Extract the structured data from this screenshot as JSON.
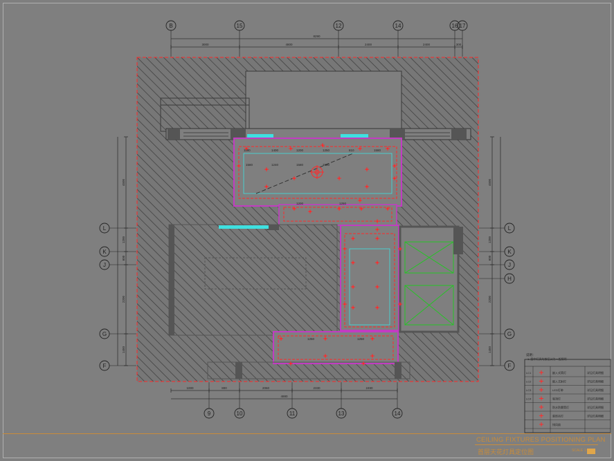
{
  "drawing": {
    "title_en": "CEILING FIXTURES POSITIONING PLAN",
    "title_cn": "首层天花灯具定位图",
    "scale": "SCALE 1:"
  },
  "grid_top": [
    "B",
    "15",
    "12",
    "14",
    "16",
    "17"
  ],
  "grid_bottom": [
    "9",
    "10",
    "11",
    "13",
    "14"
  ],
  "grid_left": [
    "L",
    "K",
    "J",
    "G",
    "F"
  ],
  "grid_right": [
    "L",
    "K",
    "J",
    "H",
    "G",
    "F"
  ],
  "dims_top": {
    "total": "8290",
    "segments": [
      "3000",
      "4800",
      "2400",
      "2400",
      "300"
    ]
  },
  "dims_bottom": {
    "total": "4880",
    "segments": [
      "1000",
      "800",
      "2060",
      "2330",
      "2490"
    ]
  },
  "dims_left": [
    "4500",
    "1200",
    "600",
    "2200",
    "1450"
  ],
  "dims_right": [
    "4500",
    "1200",
    "600",
    "2200",
    "1450"
  ],
  "room_dims": [
    "1180",
    "1400",
    "1200",
    "1250",
    "810",
    "1580",
    "1580",
    "1240",
    "1580",
    "1580",
    "1200",
    "1250",
    "1250",
    "1250"
  ],
  "legend": {
    "title": "说明：",
    "note": "1. 图中灯具均按设计为一般照明",
    "rows": [
      {
        "code": "LC1",
        "name": "嵌入式筒灯",
        "spec": "详见灯具明细"
      },
      {
        "code": "LC2",
        "name": "嵌入式射灯",
        "spec": "详见灯具明细"
      },
      {
        "code": "LC3",
        "name": "LED灯带",
        "spec": "详见灯具明细"
      },
      {
        "code": "LC4",
        "name": "吸顶灯",
        "spec": "详见灯具明细"
      },
      {
        "code": "",
        "name": "防水防雾筒灯",
        "spec": "详见灯具明细"
      },
      {
        "code": "",
        "name": "装饰吊灯",
        "spec": "详见灯具明细"
      },
      {
        "code": "",
        "name": "排风扇",
        "spec": ""
      }
    ]
  },
  "colors": {
    "background": "#7f7f7f",
    "hatch": "#3a3a3a",
    "wall": "#555555",
    "red": "#ff2a2a",
    "magenta": "#c23cc2",
    "cyan": "#3fe0e0",
    "green": "#25c425",
    "title": "#c98c3a"
  }
}
